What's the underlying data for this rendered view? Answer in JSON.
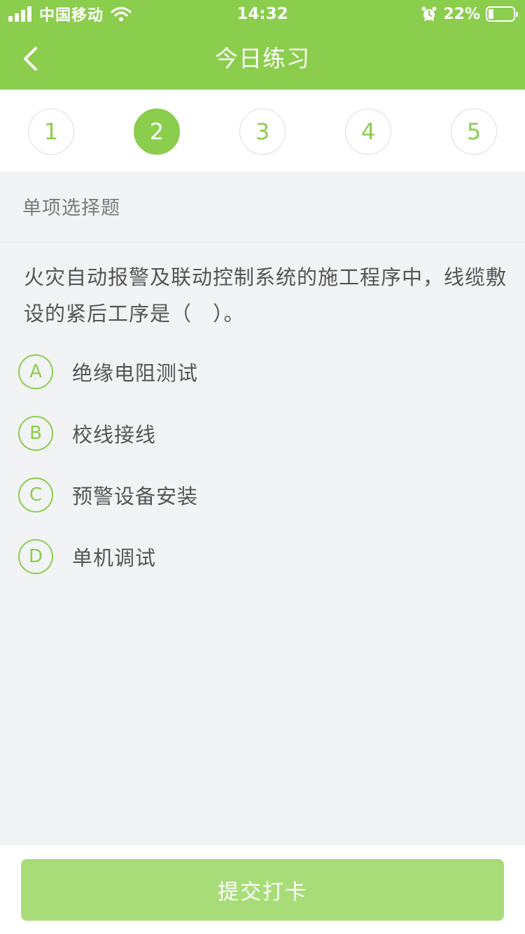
{
  "status_bar": {
    "carrier": "中国移动",
    "time": "14:32",
    "battery_percent": "22%",
    "battery_level": 0.22,
    "icons": [
      "signal-icon",
      "wifi-icon",
      "alarm-icon",
      "battery-icon"
    ]
  },
  "nav": {
    "title": "今日练习",
    "back_icon": "chevron-left-icon"
  },
  "tabs": {
    "items": [
      "1",
      "2",
      "3",
      "4",
      "5"
    ],
    "active_index": 1
  },
  "question": {
    "type_label": "单项选择题",
    "stem": "火灾自动报警及联动控制系统的施工程序中，线缆敷设的紧后工序是（　）。",
    "options": [
      {
        "letter": "A",
        "text": "绝缘电阻测试"
      },
      {
        "letter": "B",
        "text": "校线接线"
      },
      {
        "letter": "C",
        "text": "预警设备安装"
      },
      {
        "letter": "D",
        "text": "单机调试"
      }
    ]
  },
  "footer": {
    "submit_label": "提交打卡"
  },
  "colors": {
    "brand_green": "#8bcd4d",
    "submit_disabled": "#a8dc78",
    "page_bg": "#f2f3f5",
    "text_primary": "#555555",
    "text_secondary": "#7a7a7a"
  }
}
